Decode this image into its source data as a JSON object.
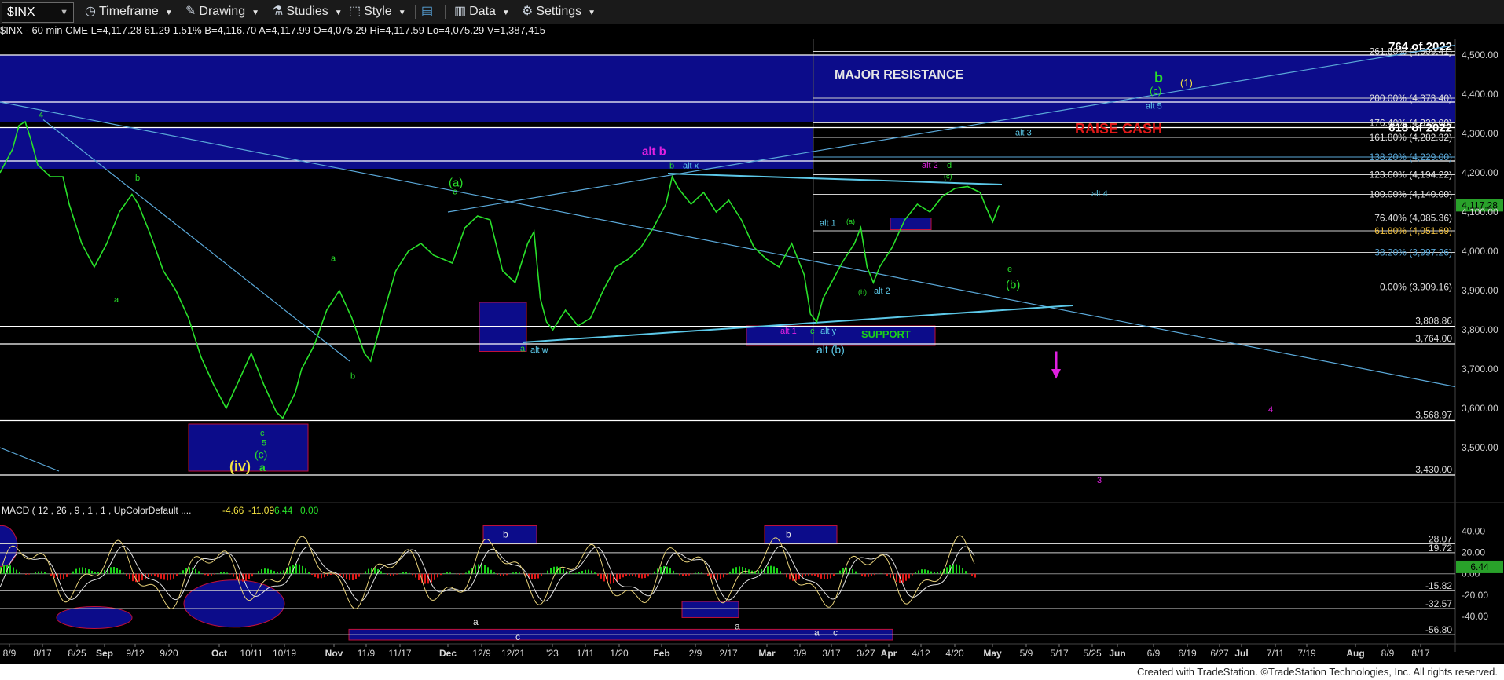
{
  "toolbar": {
    "symbol": "$INX",
    "items": [
      {
        "label": "Timeframe",
        "icon": "clock-icon"
      },
      {
        "label": "Drawing",
        "icon": "pencil-icon"
      },
      {
        "label": "Studies",
        "icon": "flask-icon"
      },
      {
        "label": "Style",
        "icon": "style-icon"
      },
      {
        "label": "",
        "icon": "layout-icon"
      },
      {
        "label": "Data",
        "icon": "bar-chart-icon"
      },
      {
        "label": "Settings",
        "icon": "gear-icon"
      }
    ]
  },
  "info_bar": "$INX - 60 min  CME  L=4,117.28  61.29  1.51%  B=4,116.70  A=4,117.99  O=4,075.29  Hi=4,117.59  Lo=4,075.29  V=1,387,415",
  "footer": "Created with TradeStation. ©TradeStation Technologies, Inc. All rights reserved.",
  "colors": {
    "price": "#29e02a",
    "support_line": "#ffffff",
    "trendline": "#5aa8d8",
    "box_fill": "#0c0c8a",
    "box_border": "#c0103a",
    "macd_line": "#e8d27a",
    "signal_line": "#e0e0e0",
    "hist_up": "#19d219",
    "hist_down": "#e01818",
    "raise_cash": "#e01818",
    "magenta": "#e020e0"
  },
  "chart_data": [
    {
      "type": "line",
      "title": "$INX - 60 min",
      "x_tick_labels": [
        "8/9",
        "8/17",
        "8/25",
        "Sep",
        "9/12",
        "9/20",
        "Oct",
        "10/11",
        "10/19",
        "Nov",
        "11/9",
        "11/17",
        "Dec",
        "12/9",
        "12/21",
        "'23",
        "1/11",
        "1/20",
        "Feb",
        "2/9",
        "2/17",
        "Mar",
        "3/9",
        "3/17",
        "3/27",
        "Apr",
        "4/12",
        "4/20",
        "May",
        "5/9",
        "5/17",
        "5/25",
        "Jun",
        "6/9",
        "6/19",
        "6/27",
        "Jul",
        "7/11",
        "7/19",
        "Aug",
        "8/9",
        "8/17"
      ],
      "y_ticks": [
        3500,
        3600,
        3700,
        3800,
        3900,
        4000,
        4100,
        4200,
        4300,
        4400,
        4500
      ],
      "y_tick_labels": [
        "3,500.00",
        "3,600.00",
        "3,700.00",
        "3,800.00",
        "3,900.00",
        "4,000.00",
        "4,100.00",
        "4,200.00",
        "4,300.00",
        "4,400.00",
        "4,500.00"
      ],
      "ylim": [
        3410,
        4540
      ],
      "current_price_label": "4,117.28",
      "price_path": [
        {
          "x": 0,
          "y": 4200
        },
        {
          "x": 2,
          "y": 4260
        },
        {
          "x": 3,
          "y": 4320
        },
        {
          "x": 4,
          "y": 4330
        },
        {
          "x": 5,
          "y": 4280
        },
        {
          "x": 6,
          "y": 4220
        },
        {
          "x": 8,
          "y": 4190
        },
        {
          "x": 10,
          "y": 4190
        },
        {
          "x": 11,
          "y": 4120
        },
        {
          "x": 13,
          "y": 4020
        },
        {
          "x": 15,
          "y": 3960
        },
        {
          "x": 17,
          "y": 4020
        },
        {
          "x": 19,
          "y": 4100
        },
        {
          "x": 21,
          "y": 4145
        },
        {
          "x": 22,
          "y": 4120
        },
        {
          "x": 24,
          "y": 4040
        },
        {
          "x": 26,
          "y": 3950
        },
        {
          "x": 28,
          "y": 3900
        },
        {
          "x": 30,
          "y": 3830
        },
        {
          "x": 32,
          "y": 3730
        },
        {
          "x": 34,
          "y": 3660
        },
        {
          "x": 36,
          "y": 3600
        },
        {
          "x": 38,
          "y": 3670
        },
        {
          "x": 40,
          "y": 3740
        },
        {
          "x": 42,
          "y": 3660
        },
        {
          "x": 44,
          "y": 3590
        },
        {
          "x": 45,
          "y": 3575
        },
        {
          "x": 47,
          "y": 3640
        },
        {
          "x": 48,
          "y": 3700
        },
        {
          "x": 50,
          "y": 3760
        },
        {
          "x": 52,
          "y": 3850
        },
        {
          "x": 54,
          "y": 3900
        },
        {
          "x": 56,
          "y": 3830
        },
        {
          "x": 58,
          "y": 3740
        },
        {
          "x": 59,
          "y": 3720
        },
        {
          "x": 61,
          "y": 3840
        },
        {
          "x": 63,
          "y": 3950
        },
        {
          "x": 65,
          "y": 4000
        },
        {
          "x": 67,
          "y": 4020
        },
        {
          "x": 69,
          "y": 3990
        },
        {
          "x": 72,
          "y": 3970
        },
        {
          "x": 74,
          "y": 4060
        },
        {
          "x": 76,
          "y": 4090
        },
        {
          "x": 78,
          "y": 4080
        },
        {
          "x": 80,
          "y": 3950
        },
        {
          "x": 82,
          "y": 3920
        },
        {
          "x": 84,
          "y": 4020
        },
        {
          "x": 85,
          "y": 4050
        },
        {
          "x": 86,
          "y": 3880
        },
        {
          "x": 87,
          "y": 3820
        },
        {
          "x": 88,
          "y": 3800
        },
        {
          "x": 90,
          "y": 3850
        },
        {
          "x": 92,
          "y": 3810
        },
        {
          "x": 94,
          "y": 3830
        },
        {
          "x": 96,
          "y": 3900
        },
        {
          "x": 98,
          "y": 3960
        },
        {
          "x": 100,
          "y": 3980
        },
        {
          "x": 102,
          "y": 4010
        },
        {
          "x": 104,
          "y": 4060
        },
        {
          "x": 106,
          "y": 4120
        },
        {
          "x": 107,
          "y": 4190
        },
        {
          "x": 108,
          "y": 4160
        },
        {
          "x": 110,
          "y": 4120
        },
        {
          "x": 112,
          "y": 4150
        },
        {
          "x": 114,
          "y": 4100
        },
        {
          "x": 116,
          "y": 4130
        },
        {
          "x": 118,
          "y": 4080
        },
        {
          "x": 120,
          "y": 4010
        },
        {
          "x": 122,
          "y": 3980
        },
        {
          "x": 124,
          "y": 3960
        },
        {
          "x": 126,
          "y": 4020
        },
        {
          "x": 128,
          "y": 3940
        },
        {
          "x": 129,
          "y": 3840
        },
        {
          "x": 130,
          "y": 3820
        },
        {
          "x": 131,
          "y": 3880
        },
        {
          "x": 132,
          "y": 3910
        },
        {
          "x": 134,
          "y": 3970
        },
        {
          "x": 136,
          "y": 4020
        },
        {
          "x": 137,
          "y": 4060
        },
        {
          "x": 138,
          "y": 3960
        },
        {
          "x": 139,
          "y": 3920
        },
        {
          "x": 140,
          "y": 3960
        },
        {
          "x": 142,
          "y": 4010
        },
        {
          "x": 144,
          "y": 4080
        },
        {
          "x": 146,
          "y": 4120
        },
        {
          "x": 148,
          "y": 4100
        },
        {
          "x": 150,
          "y": 4140
        },
        {
          "x": 152,
          "y": 4160
        },
        {
          "x": 154,
          "y": 4165
        },
        {
          "x": 156,
          "y": 4150
        },
        {
          "x": 157,
          "y": 4110
        },
        {
          "x": 158,
          "y": 4075
        },
        {
          "x": 159,
          "y": 4117
        }
      ],
      "x_max": 232,
      "horizontal_levels": [
        {
          "label": "3,430.00",
          "value": 3430
        },
        {
          "label": "3,568.97",
          "value": 3568.97
        },
        {
          "label": "3,764.00",
          "value": 3764
        },
        {
          "label": "3,808.86",
          "value": 3808.86
        },
        {
          "label": "",
          "value": 4500
        },
        {
          "label": "",
          "value": 4380
        },
        {
          "label": "",
          "value": 4315
        },
        {
          "label": "",
          "value": 4230
        }
      ],
      "fib_levels": [
        {
          "label": "261.80% (4,509.41)",
          "value": 4509
        },
        {
          "label": "200.00% (4,373.40)",
          "value": 4390
        },
        {
          "label": "176.40% (4,322.00)",
          "value": 4327
        },
        {
          "label": "161.80% (4,282.32)",
          "value": 4290
        },
        {
          "label": "138.20% (4,229.00)",
          "value": 4240
        },
        {
          "label": "123.60% (4,194.22)",
          "value": 4195
        },
        {
          "label": "100.00% (4,140.00)",
          "value": 4145
        },
        {
          "label": "76.40% (4,085.36)",
          "value": 4085
        },
        {
          "label": "61.80% (4,051.69)",
          "value": 4052
        },
        {
          "label": "38.20% (3,997.26)",
          "value": 3997
        },
        {
          "label": "0.00% (3,909.16)",
          "value": 3909
        }
      ],
      "bold_labels": [
        {
          "text": "764 of 2022",
          "value": 4522
        },
        {
          "text": "618 of 2022",
          "value": 4315
        }
      ],
      "text_labels": {
        "major_resistance": "MAJOR RESISTANCE",
        "raise_cash": "RAISE CASH",
        "support": "SUPPORT",
        "wave_iv": "(iv)",
        "wave_b_big": "b",
        "wave_c_paren": "(c)",
        "wave_1": "(1)",
        "alt_b": "alt b",
        "alt_paren_b": "alt (b)",
        "alt_5": "alt 5",
        "alt_4": "alt 4",
        "alt_3": "alt 3",
        "alt_2": "alt 2",
        "alt_2b": "alt 2",
        "alt_1": "alt 1",
        "alt_1b": "alt 1",
        "alt_x": "alt x",
        "alt_y": "alt y",
        "alt_w": "alt w",
        "wave_a_paren": "(a)",
        "wave_b_paren": "(b)",
        "wave_e": "e",
        "wave_4": "4",
        "wave_3": "3",
        "lbl_4_top": "4",
        "lbl_b1": "b",
        "lbl_a1": "a",
        "lbl_b2": "b",
        "lbl_a2": "a",
        "lbl_c1": "c",
        "lbl_5": "5",
        "lbl_c_green": "(c)",
        "lbl_a_green": "a",
        "lbl_c2": "c",
        "lbl_a3": "a",
        "lbl_b3": "b",
        "lbl_c3": "c",
        "lbl_d": "d",
        "lbl_c4": "(c)",
        "lbl_a4": "(a)",
        "lbl_b4": "(b)"
      }
    },
    {
      "type": "bar",
      "title": "MACD ( 12 , 26 , 9 , 1 , 1 , UpColorDefault ....",
      "values_header": [
        "-4.66",
        "-11.09",
        "6.44",
        "0.00"
      ],
      "y_tick_labels": [
        "40.00",
        "20.00",
        "0.00",
        "-20.00",
        "-40.00"
      ],
      "y_ticks": [
        40,
        20,
        0,
        -20,
        -40
      ],
      "ylim": [
        -62,
        52
      ],
      "level_labels": [
        {
          "label": "28.07",
          "value": 28.07
        },
        {
          "label": "19.72",
          "value": 19.72
        },
        {
          "label": "-15.82",
          "value": -15.82
        },
        {
          "label": "-32.57",
          "value": -32.57
        },
        {
          "label": "-56.80",
          "value": -56.8
        }
      ],
      "current_label": "6.44",
      "box_labels": [
        "b",
        "b",
        "a",
        "c",
        "a",
        "a",
        "c"
      ]
    }
  ]
}
